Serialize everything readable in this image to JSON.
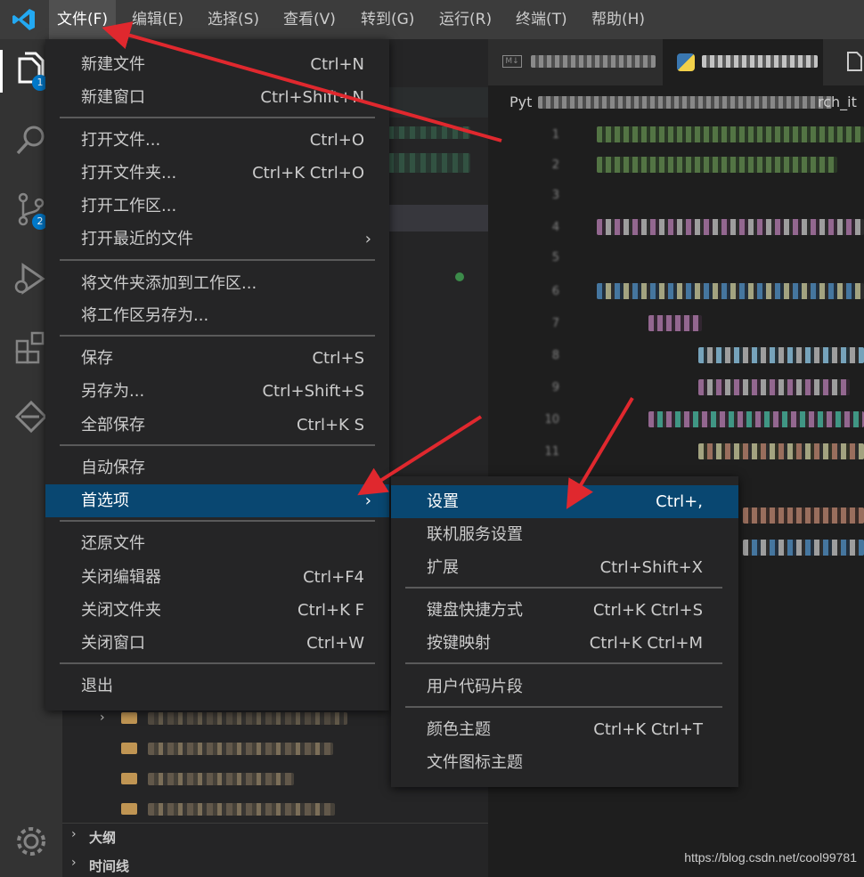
{
  "menubar": {
    "items": [
      {
        "label": "文件(F)"
      },
      {
        "label": "编辑(E)"
      },
      {
        "label": "选择(S)"
      },
      {
        "label": "查看(V)"
      },
      {
        "label": "转到(G)"
      },
      {
        "label": "运行(R)"
      },
      {
        "label": "终端(T)"
      },
      {
        "label": "帮助(H)"
      }
    ]
  },
  "activity_bar": {
    "explorer_badge": "1",
    "scm_badge": "2"
  },
  "editor": {
    "breadcrumb_prefix": "Pyt",
    "breadcrumb_suffix": "rch_it",
    "line_numbers": [
      "1",
      "2",
      "3",
      "4",
      "5",
      "6",
      "7",
      "8",
      "9",
      "10",
      "11"
    ]
  },
  "file_menu": {
    "items": [
      {
        "label": "新建文件",
        "key": "Ctrl+N"
      },
      {
        "label": "新建窗口",
        "key": "Ctrl+Shift+N"
      },
      {
        "label": "打开文件...",
        "key": "Ctrl+O"
      },
      {
        "label": "打开文件夹...",
        "key": "Ctrl+K Ctrl+O"
      },
      {
        "label": "打开工作区...",
        "key": ""
      },
      {
        "label": "打开最近的文件",
        "key": ""
      },
      {
        "label": "将文件夹添加到工作区...",
        "key": ""
      },
      {
        "label": "将工作区另存为...",
        "key": ""
      },
      {
        "label": "保存",
        "key": "Ctrl+S"
      },
      {
        "label": "另存为...",
        "key": "Ctrl+Shift+S"
      },
      {
        "label": "全部保存",
        "key": "Ctrl+K S"
      },
      {
        "label": "自动保存",
        "key": ""
      },
      {
        "label": "首选项",
        "key": ""
      },
      {
        "label": "还原文件",
        "key": ""
      },
      {
        "label": "关闭编辑器",
        "key": "Ctrl+F4"
      },
      {
        "label": "关闭文件夹",
        "key": "Ctrl+K F"
      },
      {
        "label": "关闭窗口",
        "key": "Ctrl+W"
      },
      {
        "label": "退出",
        "key": ""
      }
    ]
  },
  "preferences_menu": {
    "items": [
      {
        "label": "设置",
        "key": "Ctrl+,"
      },
      {
        "label": "联机服务设置",
        "key": ""
      },
      {
        "label": "扩展",
        "key": "Ctrl+Shift+X"
      },
      {
        "label": "键盘快捷方式",
        "key": "Ctrl+K Ctrl+S"
      },
      {
        "label": "按键映射",
        "key": "Ctrl+K Ctrl+M"
      },
      {
        "label": "用户代码片段",
        "key": ""
      },
      {
        "label": "颜色主题",
        "key": "Ctrl+K Ctrl+T"
      },
      {
        "label": "文件图标主题",
        "key": ""
      }
    ]
  },
  "sidebar": {
    "outline_label": "大纲",
    "timeline_label": "时间线"
  },
  "watermark": "https://blog.csdn.net/cool99781",
  "colors": {
    "menu_selected": "#094771",
    "accent": "#007acc",
    "arrow": "#e0282e"
  }
}
